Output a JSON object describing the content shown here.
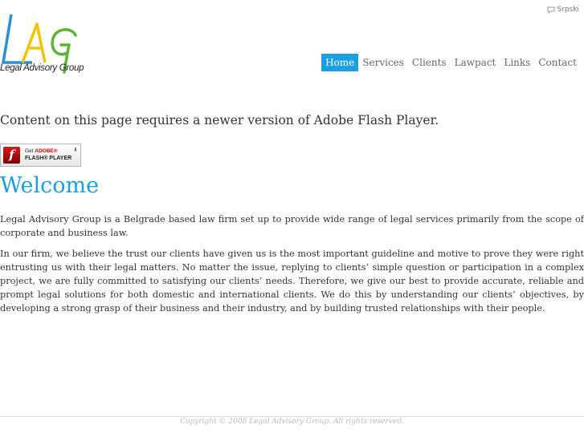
{
  "header": {
    "language_link": "Srpski",
    "logo": {
      "text": "Legal Advisory Group",
      "letters": "LAG"
    }
  },
  "nav": {
    "items": [
      {
        "label": "Home",
        "active": true
      },
      {
        "label": "Services",
        "active": false
      },
      {
        "label": "Clients",
        "active": false
      },
      {
        "label": "Lawpact",
        "active": false
      },
      {
        "label": "Links",
        "active": false
      },
      {
        "label": "Contact",
        "active": false
      }
    ]
  },
  "main": {
    "flash_message": "Content on this page requires a newer version of Adobe Flash Player.",
    "flash_badge": {
      "line1_prefix": "Get ",
      "line1_brand": "ADOBE®",
      "line2": "FLASH® PLAYER"
    },
    "welcome_title": "Welcome",
    "paragraph1": "Legal Advisory Group is a Belgrade based law firm set up to provide wide range of legal services primarily from the scope of corporate and business law.",
    "paragraph2": "In our firm, we believe the trust our clients have given us is the most important guideline and motive to prove they were right entrusting us with their legal matters. No matter the issue, replying to clients’ simple question or participation in a complex project, we are fully committed to satisfying our clients’ needs. Therefore, we give our best to provide accurate, reliable and prompt legal solutions for both domestic and international clients. We do this by understanding our clients’ objectives, by developing a strong grasp of their business and their industry, and by building trusted relationships with their people."
  },
  "footer": {
    "copyright": "Copyright © 2008 Legal Advisory Group. All rights reserved."
  },
  "colors": {
    "accent": "#1a9fe0",
    "logo_blue": "#2a8fd6",
    "logo_yellow": "#f2c400",
    "logo_green": "#5bb531"
  }
}
